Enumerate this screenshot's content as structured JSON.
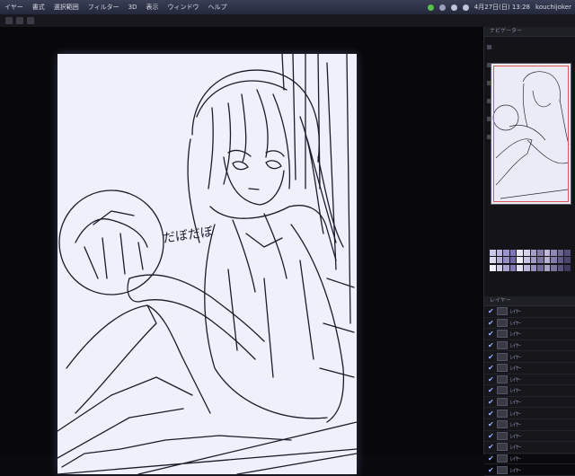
{
  "menu": {
    "items": [
      "イヤー",
      "書式",
      "選択範囲",
      "フィルター",
      "3D",
      "表示",
      "ウィンドウ",
      "ヘルプ"
    ],
    "clock": "4月27日(日) 13:28",
    "user": "kouchijoker"
  },
  "canvas": {
    "doodle_text": "だぼだぼ"
  },
  "panels": {
    "navigator_title": "ナビゲーター",
    "layers_title": "レイヤー",
    "layers": [
      "ﾚｲﾔｰ",
      "ﾚｲﾔｰ",
      "ﾚｲﾔｰ",
      "ﾚｲﾔｰ",
      "ﾚｲﾔｰ",
      "ﾚｲﾔｰ",
      "ﾚｲﾔｰ",
      "ﾚｲﾔｰ",
      "ﾚｲﾔｰ",
      "ﾚｲﾔｰ",
      "ﾚｲﾔｰ",
      "ﾚｲﾔｰ",
      "ﾚｲﾔｰ",
      "ﾚｲﾔｰ",
      "ﾚｲﾔｰ"
    ]
  },
  "swatch_colors": [
    "#c9c7e8",
    "#b9b4e0",
    "#9a93c9",
    "#7d76b4",
    "#e7e4f3",
    "#d5d2ea",
    "#a49fc7",
    "#867ea9",
    "#c2b9d8",
    "#8f87b5",
    "#6d6793",
    "#54507a",
    "#dcd8ef",
    "#b5afd4",
    "#948dc0",
    "#6f68a3",
    "#f0eef8",
    "#c8c3e2",
    "#9f99c4",
    "#7b749f",
    "#b8b0d1",
    "#847caa",
    "#625b87",
    "#49456b",
    "#efedf9",
    "#d1cde8",
    "#aaa3ce",
    "#817ab0",
    "#e3e0f1",
    "#bcb7da",
    "#9790be",
    "#726b99",
    "#a9a2c6",
    "#7a739d",
    "#5a547c",
    "#3f3b5e"
  ]
}
